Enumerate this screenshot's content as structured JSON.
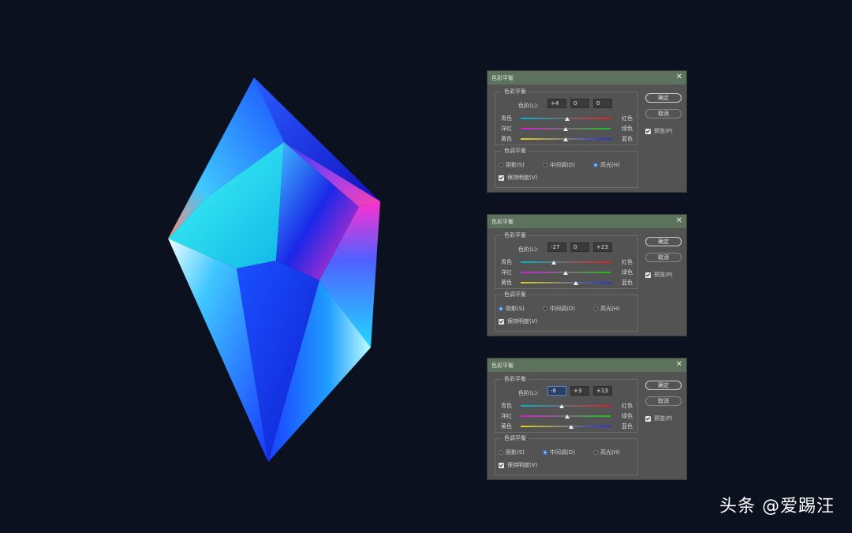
{
  "dialogs": [
    {
      "title": "色彩平衡",
      "group_color_balance": "色彩平衡",
      "levels_label": "色阶(L):",
      "levels": [
        "+4",
        "0",
        "0"
      ],
      "focused_level": -1,
      "sliders": [
        {
          "left": "青色",
          "right": "红色",
          "value": 4
        },
        {
          "left": "洋红",
          "right": "绿色",
          "value": 0
        },
        {
          "left": "黄色",
          "right": "蓝色",
          "value": 0
        }
      ],
      "group_tone_balance": "色调平衡",
      "radios": [
        "阴影(S)",
        "中间调(D)",
        "高光(H)"
      ],
      "selected_radio": 2,
      "preserve_luminosity": "保持明度(V)",
      "ok": "确定",
      "cancel": "取消",
      "preview": "预览(P)"
    },
    {
      "title": "色彩平衡",
      "group_color_balance": "色彩平衡",
      "levels_label": "色阶(L):",
      "levels": [
        "-27",
        "0",
        "+23"
      ],
      "focused_level": -1,
      "sliders": [
        {
          "left": "青色",
          "right": "红色",
          "value": -27
        },
        {
          "left": "洋红",
          "right": "绿色",
          "value": 0
        },
        {
          "left": "黄色",
          "right": "蓝色",
          "value": 23
        }
      ],
      "group_tone_balance": "色调平衡",
      "radios": [
        "阴影(S)",
        "中间调(D)",
        "高光(H)"
      ],
      "selected_radio": 0,
      "preserve_luminosity": "保持明度(V)",
      "ok": "确定",
      "cancel": "取消",
      "preview": "预览(P)"
    },
    {
      "title": "色彩平衡",
      "group_color_balance": "色彩平衡",
      "levels_label": "色阶(L):",
      "levels": [
        "-8",
        "+3",
        "+13"
      ],
      "focused_level": 0,
      "sliders": [
        {
          "left": "青色",
          "right": "红色",
          "value": -8
        },
        {
          "left": "洋红",
          "right": "绿色",
          "value": 3
        },
        {
          "left": "黄色",
          "right": "蓝色",
          "value": 13
        }
      ],
      "group_tone_balance": "色调平衡",
      "radios": [
        "阴影(S)",
        "中间调(D)",
        "高光(H)"
      ],
      "selected_radio": 1,
      "preserve_luminosity": "保持明度(V)",
      "ok": "确定",
      "cancel": "取消",
      "preview": "预览(P)"
    }
  ],
  "watermark": "头条 @爱踢汪"
}
